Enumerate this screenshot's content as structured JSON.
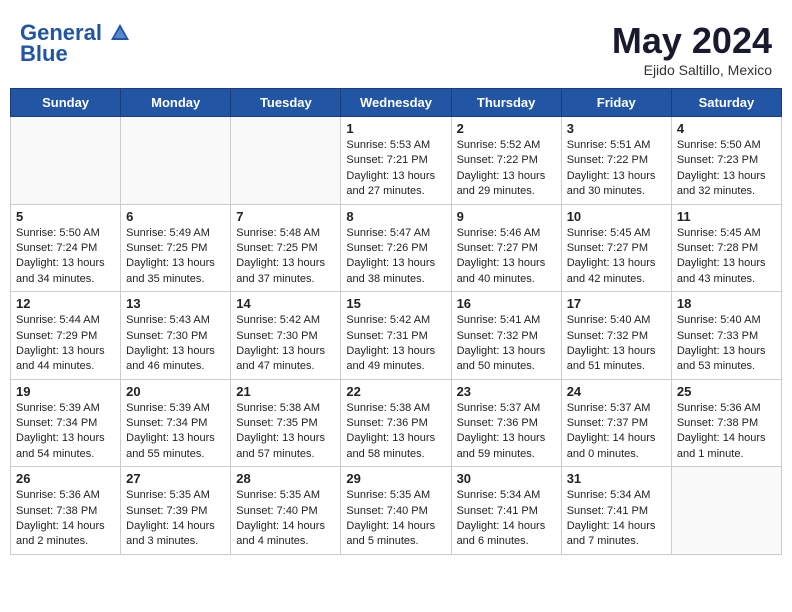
{
  "header": {
    "logo_text1": "General",
    "logo_text2": "Blue",
    "month_year": "May 2024",
    "location": "Ejido Saltillo, Mexico"
  },
  "days_of_week": [
    "Sunday",
    "Monday",
    "Tuesday",
    "Wednesday",
    "Thursday",
    "Friday",
    "Saturday"
  ],
  "weeks": [
    [
      {
        "day": "",
        "content": ""
      },
      {
        "day": "",
        "content": ""
      },
      {
        "day": "",
        "content": ""
      },
      {
        "day": "1",
        "content": "Sunrise: 5:53 AM\nSunset: 7:21 PM\nDaylight: 13 hours\nand 27 minutes."
      },
      {
        "day": "2",
        "content": "Sunrise: 5:52 AM\nSunset: 7:22 PM\nDaylight: 13 hours\nand 29 minutes."
      },
      {
        "day": "3",
        "content": "Sunrise: 5:51 AM\nSunset: 7:22 PM\nDaylight: 13 hours\nand 30 minutes."
      },
      {
        "day": "4",
        "content": "Sunrise: 5:50 AM\nSunset: 7:23 PM\nDaylight: 13 hours\nand 32 minutes."
      }
    ],
    [
      {
        "day": "5",
        "content": "Sunrise: 5:50 AM\nSunset: 7:24 PM\nDaylight: 13 hours\nand 34 minutes."
      },
      {
        "day": "6",
        "content": "Sunrise: 5:49 AM\nSunset: 7:25 PM\nDaylight: 13 hours\nand 35 minutes."
      },
      {
        "day": "7",
        "content": "Sunrise: 5:48 AM\nSunset: 7:25 PM\nDaylight: 13 hours\nand 37 minutes."
      },
      {
        "day": "8",
        "content": "Sunrise: 5:47 AM\nSunset: 7:26 PM\nDaylight: 13 hours\nand 38 minutes."
      },
      {
        "day": "9",
        "content": "Sunrise: 5:46 AM\nSunset: 7:27 PM\nDaylight: 13 hours\nand 40 minutes."
      },
      {
        "day": "10",
        "content": "Sunrise: 5:45 AM\nSunset: 7:27 PM\nDaylight: 13 hours\nand 42 minutes."
      },
      {
        "day": "11",
        "content": "Sunrise: 5:45 AM\nSunset: 7:28 PM\nDaylight: 13 hours\nand 43 minutes."
      }
    ],
    [
      {
        "day": "12",
        "content": "Sunrise: 5:44 AM\nSunset: 7:29 PM\nDaylight: 13 hours\nand 44 minutes."
      },
      {
        "day": "13",
        "content": "Sunrise: 5:43 AM\nSunset: 7:30 PM\nDaylight: 13 hours\nand 46 minutes."
      },
      {
        "day": "14",
        "content": "Sunrise: 5:42 AM\nSunset: 7:30 PM\nDaylight: 13 hours\nand 47 minutes."
      },
      {
        "day": "15",
        "content": "Sunrise: 5:42 AM\nSunset: 7:31 PM\nDaylight: 13 hours\nand 49 minutes."
      },
      {
        "day": "16",
        "content": "Sunrise: 5:41 AM\nSunset: 7:32 PM\nDaylight: 13 hours\nand 50 minutes."
      },
      {
        "day": "17",
        "content": "Sunrise: 5:40 AM\nSunset: 7:32 PM\nDaylight: 13 hours\nand 51 minutes."
      },
      {
        "day": "18",
        "content": "Sunrise: 5:40 AM\nSunset: 7:33 PM\nDaylight: 13 hours\nand 53 minutes."
      }
    ],
    [
      {
        "day": "19",
        "content": "Sunrise: 5:39 AM\nSunset: 7:34 PM\nDaylight: 13 hours\nand 54 minutes."
      },
      {
        "day": "20",
        "content": "Sunrise: 5:39 AM\nSunset: 7:34 PM\nDaylight: 13 hours\nand 55 minutes."
      },
      {
        "day": "21",
        "content": "Sunrise: 5:38 AM\nSunset: 7:35 PM\nDaylight: 13 hours\nand 57 minutes."
      },
      {
        "day": "22",
        "content": "Sunrise: 5:38 AM\nSunset: 7:36 PM\nDaylight: 13 hours\nand 58 minutes."
      },
      {
        "day": "23",
        "content": "Sunrise: 5:37 AM\nSunset: 7:36 PM\nDaylight: 13 hours\nand 59 minutes."
      },
      {
        "day": "24",
        "content": "Sunrise: 5:37 AM\nSunset: 7:37 PM\nDaylight: 14 hours\nand 0 minutes."
      },
      {
        "day": "25",
        "content": "Sunrise: 5:36 AM\nSunset: 7:38 PM\nDaylight: 14 hours\nand 1 minute."
      }
    ],
    [
      {
        "day": "26",
        "content": "Sunrise: 5:36 AM\nSunset: 7:38 PM\nDaylight: 14 hours\nand 2 minutes."
      },
      {
        "day": "27",
        "content": "Sunrise: 5:35 AM\nSunset: 7:39 PM\nDaylight: 14 hours\nand 3 minutes."
      },
      {
        "day": "28",
        "content": "Sunrise: 5:35 AM\nSunset: 7:40 PM\nDaylight: 14 hours\nand 4 minutes."
      },
      {
        "day": "29",
        "content": "Sunrise: 5:35 AM\nSunset: 7:40 PM\nDaylight: 14 hours\nand 5 minutes."
      },
      {
        "day": "30",
        "content": "Sunrise: 5:34 AM\nSunset: 7:41 PM\nDaylight: 14 hours\nand 6 minutes."
      },
      {
        "day": "31",
        "content": "Sunrise: 5:34 AM\nSunset: 7:41 PM\nDaylight: 14 hours\nand 7 minutes."
      },
      {
        "day": "",
        "content": ""
      }
    ]
  ]
}
